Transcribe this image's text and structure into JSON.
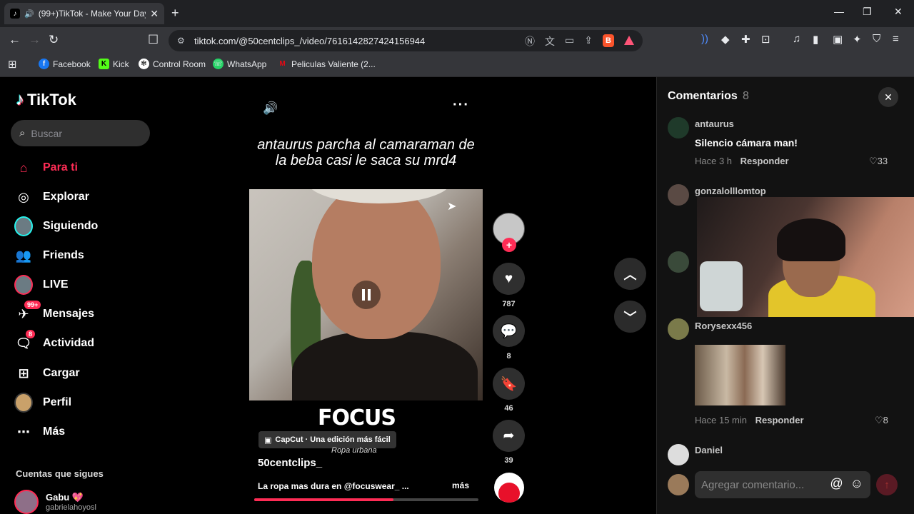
{
  "browser": {
    "tab_title": "(99+)TikTok - Make Your Day",
    "url": "tiktok.com/@50centclips_/video/7616142827424156944",
    "bookmarks": [
      {
        "label": "Facebook",
        "icon": "facebook-icon",
        "color": "#1877f2"
      },
      {
        "label": "Kick",
        "icon": "kick-icon",
        "color": "#53fc18"
      },
      {
        "label": "Control Room",
        "icon": "control-room-icon",
        "color": "#ffffff"
      },
      {
        "label": "WhatsApp",
        "icon": "whatsapp-icon",
        "color": "#25d366"
      },
      {
        "label": "Peliculas Valiente (2...",
        "icon": "peliculas-icon",
        "color": "#e50914"
      }
    ]
  },
  "sidebar": {
    "brand": "TikTok",
    "search_placeholder": "Buscar",
    "items": [
      {
        "label": "Para ti",
        "icon": "home-icon"
      },
      {
        "label": "Explorar",
        "icon": "compass-icon"
      },
      {
        "label": "Siguiendo",
        "icon": "following-avatar"
      },
      {
        "label": "Friends",
        "icon": "friends-icon"
      },
      {
        "label": "LIVE",
        "icon": "live-avatar"
      },
      {
        "label": "Mensajes",
        "icon": "messages-icon",
        "badge": "99+"
      },
      {
        "label": "Actividad",
        "icon": "activity-icon",
        "badge": "8"
      },
      {
        "label": "Cargar",
        "icon": "upload-icon"
      },
      {
        "label": "Perfil",
        "icon": "profile-avatar"
      },
      {
        "label": "Más",
        "icon": "more-icon"
      }
    ],
    "following_title": "Cuentas que sigues",
    "following": [
      {
        "name": "Gabu 💖",
        "handle": "gabrielahoyosl"
      }
    ]
  },
  "video": {
    "overlay_caption": "antaurus parcha al camaraman de la beba casi le saca su mrd4",
    "brand_text": "FOCUS",
    "brand_sub": "Ropa urbana",
    "capcut": "CapCut · Una edición más fácil",
    "author": "50centclips_",
    "description": "La ropa mas dura en @focuswear_ ...",
    "more": "más",
    "progress": 0.62,
    "likes": "787",
    "comments": "8",
    "saves": "46",
    "shares": "39"
  },
  "comments": {
    "title": "Comentarios",
    "count": "8",
    "items": [
      {
        "user": "antaurus",
        "text": "Silencio cámara man!",
        "time": "Hace 3 h",
        "reply": "Responder",
        "likes": "33"
      },
      {
        "user": "gonzalolllomtop"
      },
      {
        "user": "Rorysexx456",
        "time": "Hace 15 min",
        "reply": "Responder",
        "likes": "8"
      },
      {
        "user": "Daniel"
      }
    ],
    "input_placeholder": "Agregar comentario..."
  }
}
